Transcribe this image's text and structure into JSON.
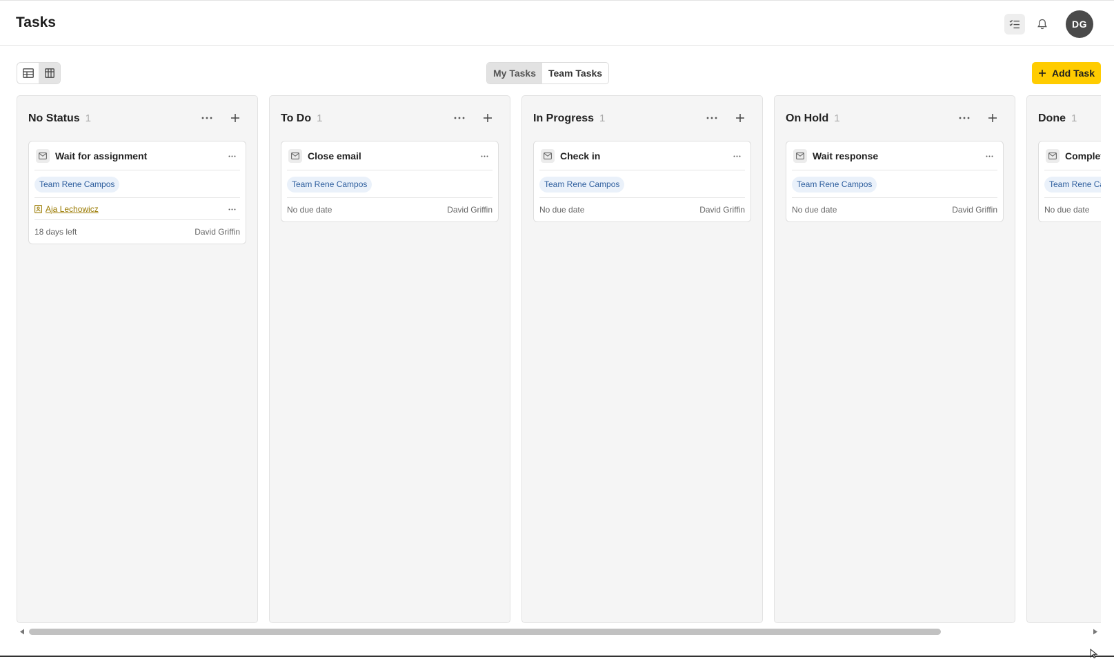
{
  "header": {
    "title": "Tasks",
    "user_initials": "DG"
  },
  "toolbar": {
    "tabs": [
      {
        "label": "My Tasks",
        "active": true
      },
      {
        "label": "Team Tasks",
        "active": false
      }
    ],
    "add_task_label": "Add Task"
  },
  "columns": [
    {
      "title": "No Status",
      "count": "1",
      "card": {
        "title": "Wait for assignment",
        "tag": "Team Rene Campos",
        "contact": "Aja Lechowicz",
        "due": "18 days left",
        "assignee": "David Griffin"
      }
    },
    {
      "title": "To Do",
      "count": "1",
      "card": {
        "title": "Close email",
        "tag": "Team Rene Campos",
        "due": "No due date",
        "assignee": "David Griffin"
      }
    },
    {
      "title": "In Progress",
      "count": "1",
      "card": {
        "title": "Check in",
        "tag": "Team Rene Campos",
        "due": "No due date",
        "assignee": "David Griffin"
      }
    },
    {
      "title": "On Hold",
      "count": "1",
      "card": {
        "title": "Wait response",
        "tag": "Team Rene Campos",
        "due": "No due date",
        "assignee": "David Griffin"
      }
    },
    {
      "title": "Done",
      "count": "1",
      "card": {
        "title": "Complete",
        "tag": "Team Rene Ca",
        "due": "No due date",
        "assignee": ""
      }
    }
  ],
  "colors": {
    "accent": "#ffcc00",
    "tag_bg": "#eaf1fa",
    "tag_text": "#2f5f9e"
  }
}
